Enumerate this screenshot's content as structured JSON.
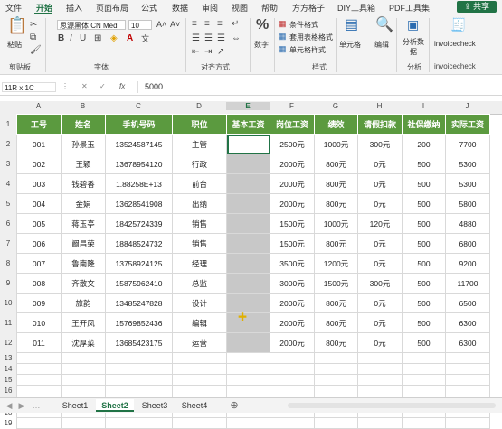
{
  "menu": {
    "items": [
      "文件",
      "开始",
      "插入",
      "页面布局",
      "公式",
      "数据",
      "审阅",
      "视图",
      "帮助",
      "方方格子",
      "DIY工具箱",
      "PDF工具集"
    ],
    "share": "共享"
  },
  "ribbon": {
    "paste": "粘贴",
    "clipboard": "剪贴板",
    "font_name": "思源黑体 CN Medi",
    "font_size": "10",
    "font_group": "字体",
    "align_group": "对齐方式",
    "number_label": "数字",
    "cond_format": "条件格式",
    "table_format": "套用表格格式",
    "cell_style": "单元格样式",
    "style_group": "样式",
    "cells_label": "单元格",
    "edit_label": "编辑",
    "analyze_label": "分析数据",
    "analyze_group": "分析",
    "invoice_btn": "invoicecheck",
    "invoice_group": "invoicecheck"
  },
  "formula_bar": {
    "name_box": "11R x 1C",
    "fx": "fx",
    "value": "5000"
  },
  "columns": [
    "A",
    "B",
    "C",
    "D",
    "E",
    "F",
    "G",
    "H",
    "I",
    "J"
  ],
  "rows": [
    "1",
    "2",
    "3",
    "4",
    "5",
    "6",
    "7",
    "8",
    "9",
    "10",
    "11",
    "12",
    "13",
    "14",
    "15",
    "16",
    "17",
    "18",
    "19"
  ],
  "table": {
    "headers": [
      "工号",
      "姓名",
      "手机号码",
      "职位",
      "基本工资",
      "岗位工资",
      "绩效",
      "请假扣款",
      "社保缴纳",
      "实际工资"
    ],
    "rows": [
      [
        "001",
        "孙景玉",
        "13524587145",
        "主管",
        "",
        "2500元",
        "1000元",
        "300元",
        "200",
        "7700"
      ],
      [
        "002",
        "王颖",
        "13678954120",
        "行政",
        "",
        "2000元",
        "800元",
        "0元",
        "500",
        "5300"
      ],
      [
        "003",
        "钱碧香",
        "1.88258E+13",
        "前台",
        "",
        "2000元",
        "800元",
        "0元",
        "500",
        "5300"
      ],
      [
        "004",
        "金娟",
        "13628541908",
        "出纳",
        "",
        "2000元",
        "800元",
        "0元",
        "500",
        "5800"
      ],
      [
        "005",
        "蒋玉亭",
        "18425724339",
        "销售",
        "",
        "1500元",
        "1000元",
        "120元",
        "500",
        "4880"
      ],
      [
        "006",
        "阚昌荣",
        "18848524732",
        "销售",
        "",
        "1500元",
        "800元",
        "0元",
        "500",
        "6800"
      ],
      [
        "007",
        "鲁南隆",
        "13758924125",
        "经理",
        "",
        "3500元",
        "1200元",
        "0元",
        "500",
        "9200"
      ],
      [
        "008",
        "齐散文",
        "15875962410",
        "总监",
        "",
        "3000元",
        "1500元",
        "300元",
        "500",
        "11700"
      ],
      [
        "009",
        "旅韵",
        "13485247828",
        "设计",
        "",
        "2000元",
        "800元",
        "0元",
        "500",
        "6500"
      ],
      [
        "010",
        "王开凤",
        "15769852436",
        "编辑",
        "",
        "2000元",
        "800元",
        "0元",
        "500",
        "6300"
      ],
      [
        "011",
        "沈厚菜",
        "13685423175",
        "运营",
        "",
        "2000元",
        "800元",
        "0元",
        "500",
        "6300"
      ]
    ]
  },
  "sheets": [
    "Sheet1",
    "Sheet2",
    "Sheet3",
    "Sheet4"
  ],
  "active_sheet": "Sheet2",
  "colors": {
    "accent": "#217346",
    "header_fill": "#5b9a3f",
    "selection": "#c8c8c8"
  }
}
